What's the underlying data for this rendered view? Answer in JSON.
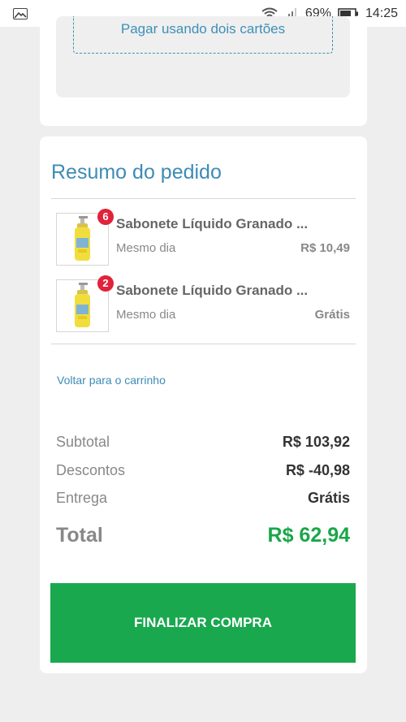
{
  "status_bar": {
    "battery": "69%",
    "time": "14:25",
    "icons": [
      "gallery-icon",
      "wifi-icon",
      "signal-icon",
      "battery-icon"
    ]
  },
  "payment": {
    "split_cards_label": "Pagar usando dois cartões"
  },
  "summary": {
    "title": "Resumo do pedido",
    "items": [
      {
        "quantity": "6",
        "name": "Sabonete Líquido Granado ...",
        "shipping": "Mesmo dia",
        "price": "R$ 10,49",
        "thumbnail": "soap-bottle-image"
      },
      {
        "quantity": "2",
        "name": "Sabonete Líquido Granado ...",
        "shipping": "Mesmo dia",
        "price": "Grátis",
        "thumbnail": "soap-bottle-image"
      }
    ],
    "back_link": "Voltar para o carrinho",
    "subtotal_label": "Subtotal",
    "subtotal_value": "R$ 103,92",
    "discount_label": "Descontos",
    "discount_value": "R$ -40,98",
    "delivery_label": "Entrega",
    "delivery_value": "Grátis",
    "total_label": "Total",
    "total_value": "R$ 62,94",
    "checkout_label": "FINALIZAR COMPRA"
  },
  "colors": {
    "accent": "#3e8cb5",
    "success": "#19a74a",
    "cta": "#1aa84f",
    "badge": "#e0223a"
  }
}
